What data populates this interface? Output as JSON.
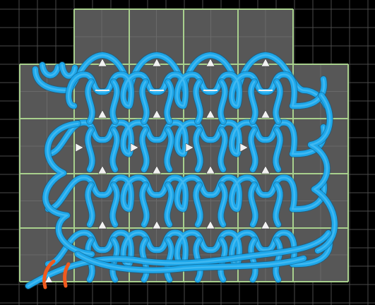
{
  "app": {
    "view": "knit-stitch-canvas"
  },
  "palette": {
    "background": "#000000",
    "minor_grid": "#4a4a4a",
    "tile_fill": "#575757",
    "tile_edge": "#a8d08d",
    "yarn_main": "#1ea7ea",
    "yarn_highlight": "#5cc8f7",
    "yarn_end": "#f05a1e",
    "stitch_marker": "#f2f2f2"
  },
  "icons": {
    "loop_marker": "triangle-up",
    "direction_marker": "triangle-right"
  }
}
